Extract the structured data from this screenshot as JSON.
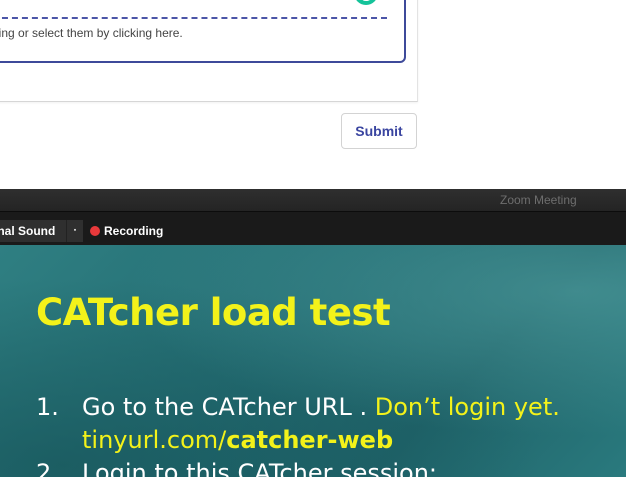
{
  "form": {
    "drop_hint": "bing or select them by clicking here.",
    "grammarly_glyph": "G",
    "submit_label": "Submit"
  },
  "zoom": {
    "window_title": "Zoom Meeting",
    "sound_label": "inal Sound",
    "dropdown_glyph": "▪",
    "recording_label": "Recording"
  },
  "slide": {
    "title": "CATcher load test",
    "item1": {
      "number": "1.",
      "text": "Go to the CATcher URL . ",
      "highlight": "Don’t login yet.",
      "url_prefix": "tinyurl.com/",
      "url_bold": "catcher-web"
    },
    "item2": {
      "number": "2.",
      "text": "Login to this CATcher session:"
    }
  },
  "colors": {
    "accent_blue": "#3a45a0",
    "slide_yellow": "#f3f21a",
    "slide_teal": "#236c72",
    "recording_red": "#e8393b",
    "grammarly_green": "#15c39a"
  }
}
